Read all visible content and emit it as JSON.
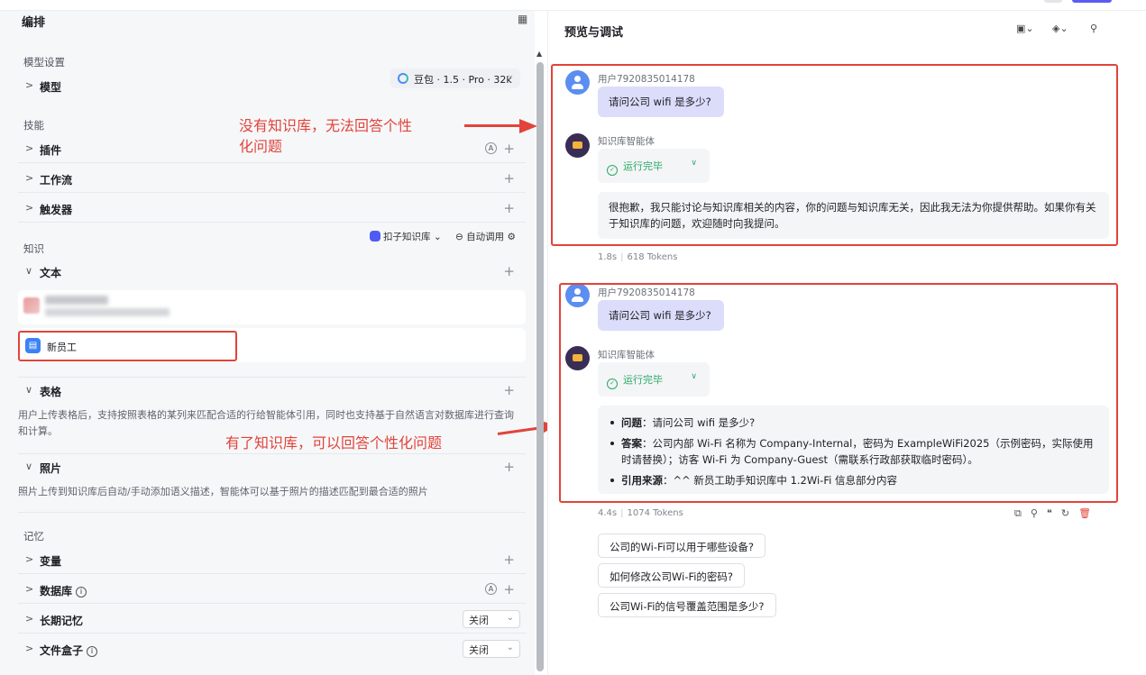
{
  "left": {
    "title": "编排",
    "layout_icon": "layout-icon",
    "model_section": "模型设置",
    "model_label": "模型",
    "model_value": "豆包 · 1.5 · Pro · 32k",
    "skills_section": "技能",
    "plugins": "插件",
    "workflow": "工作流",
    "trigger": "触发器",
    "knowledge_section": "知识",
    "kb_selector": "扣子知识库",
    "auto_call": "自动调用",
    "text": "文本",
    "new_employee": "新员工",
    "table": "表格",
    "table_desc": "用户上传表格后，支持按照表格的某列来匹配合适的行给智能体引用，同时也支持基于自然语言对数据库进行查询和计算。",
    "photo": "照片",
    "photo_desc": "照片上传到知识库后自动/手动添加语义描述，智能体可以基于照片的描述匹配到最合适的照片",
    "memory_section": "记忆",
    "variables": "变量",
    "database": "数据库",
    "long_memory": "长期记忆",
    "long_memory_value": "关闭",
    "file_box": "文件盒子",
    "file_box_value": "关闭",
    "plus": "+",
    "auto_badge": "A",
    "info": "i"
  },
  "annotations": {
    "note_top": "没有知识库，无法回答个性\n化问题",
    "note_bottom": "有了知识库，可以回答个性化问题"
  },
  "right": {
    "title": "预览与调试",
    "conv1": {
      "user_name": "用户7920835014178",
      "question": "请问公司 wifi 是多少?",
      "bot_name": "知识库智能体",
      "status": "运行完毕",
      "answer": "很抱歉，我只能讨论与知识库相关的内容，你的问题与知识库无关，因此我无法为你提供帮助。如果你有关于知识库的问题，欢迎随时向我提问。",
      "time": "1.8s",
      "tokens": "618 Tokens"
    },
    "conv2": {
      "user_name": "用户7920835014178",
      "question": "请问公司 wifi 是多少?",
      "bot_name": "知识库智能体",
      "status": "运行完毕",
      "q_label": "问题",
      "q_text": "：请问公司 wifi 是多少?",
      "a_label": "答案",
      "a_text": "：公司内部 Wi-Fi 名称为 Company-Internal，密码为 ExampleWiFi2025（示例密码，实际使用时请替换）；访客 Wi-Fi 为 Company-Guest（需联系行政部获取临时密码）。",
      "s_label": "引用来源",
      "s_text": "：^^ 新员工助手知识库中 1.2Wi-Fi 信息部分内容",
      "time": "4.4s",
      "tokens": "1074 Tokens"
    },
    "suggestions": [
      "公司的Wi-Fi可以用于哪些设备?",
      "如何修改公司Wi-Fi的密码?",
      "公司Wi-Fi的信号覆盖范围是多少?"
    ]
  },
  "colors": {
    "accent": "#5a5cf0",
    "annotation_red": "#e1443a",
    "success_green": "#2aa866",
    "user_bubble": "#dcdcfb"
  }
}
